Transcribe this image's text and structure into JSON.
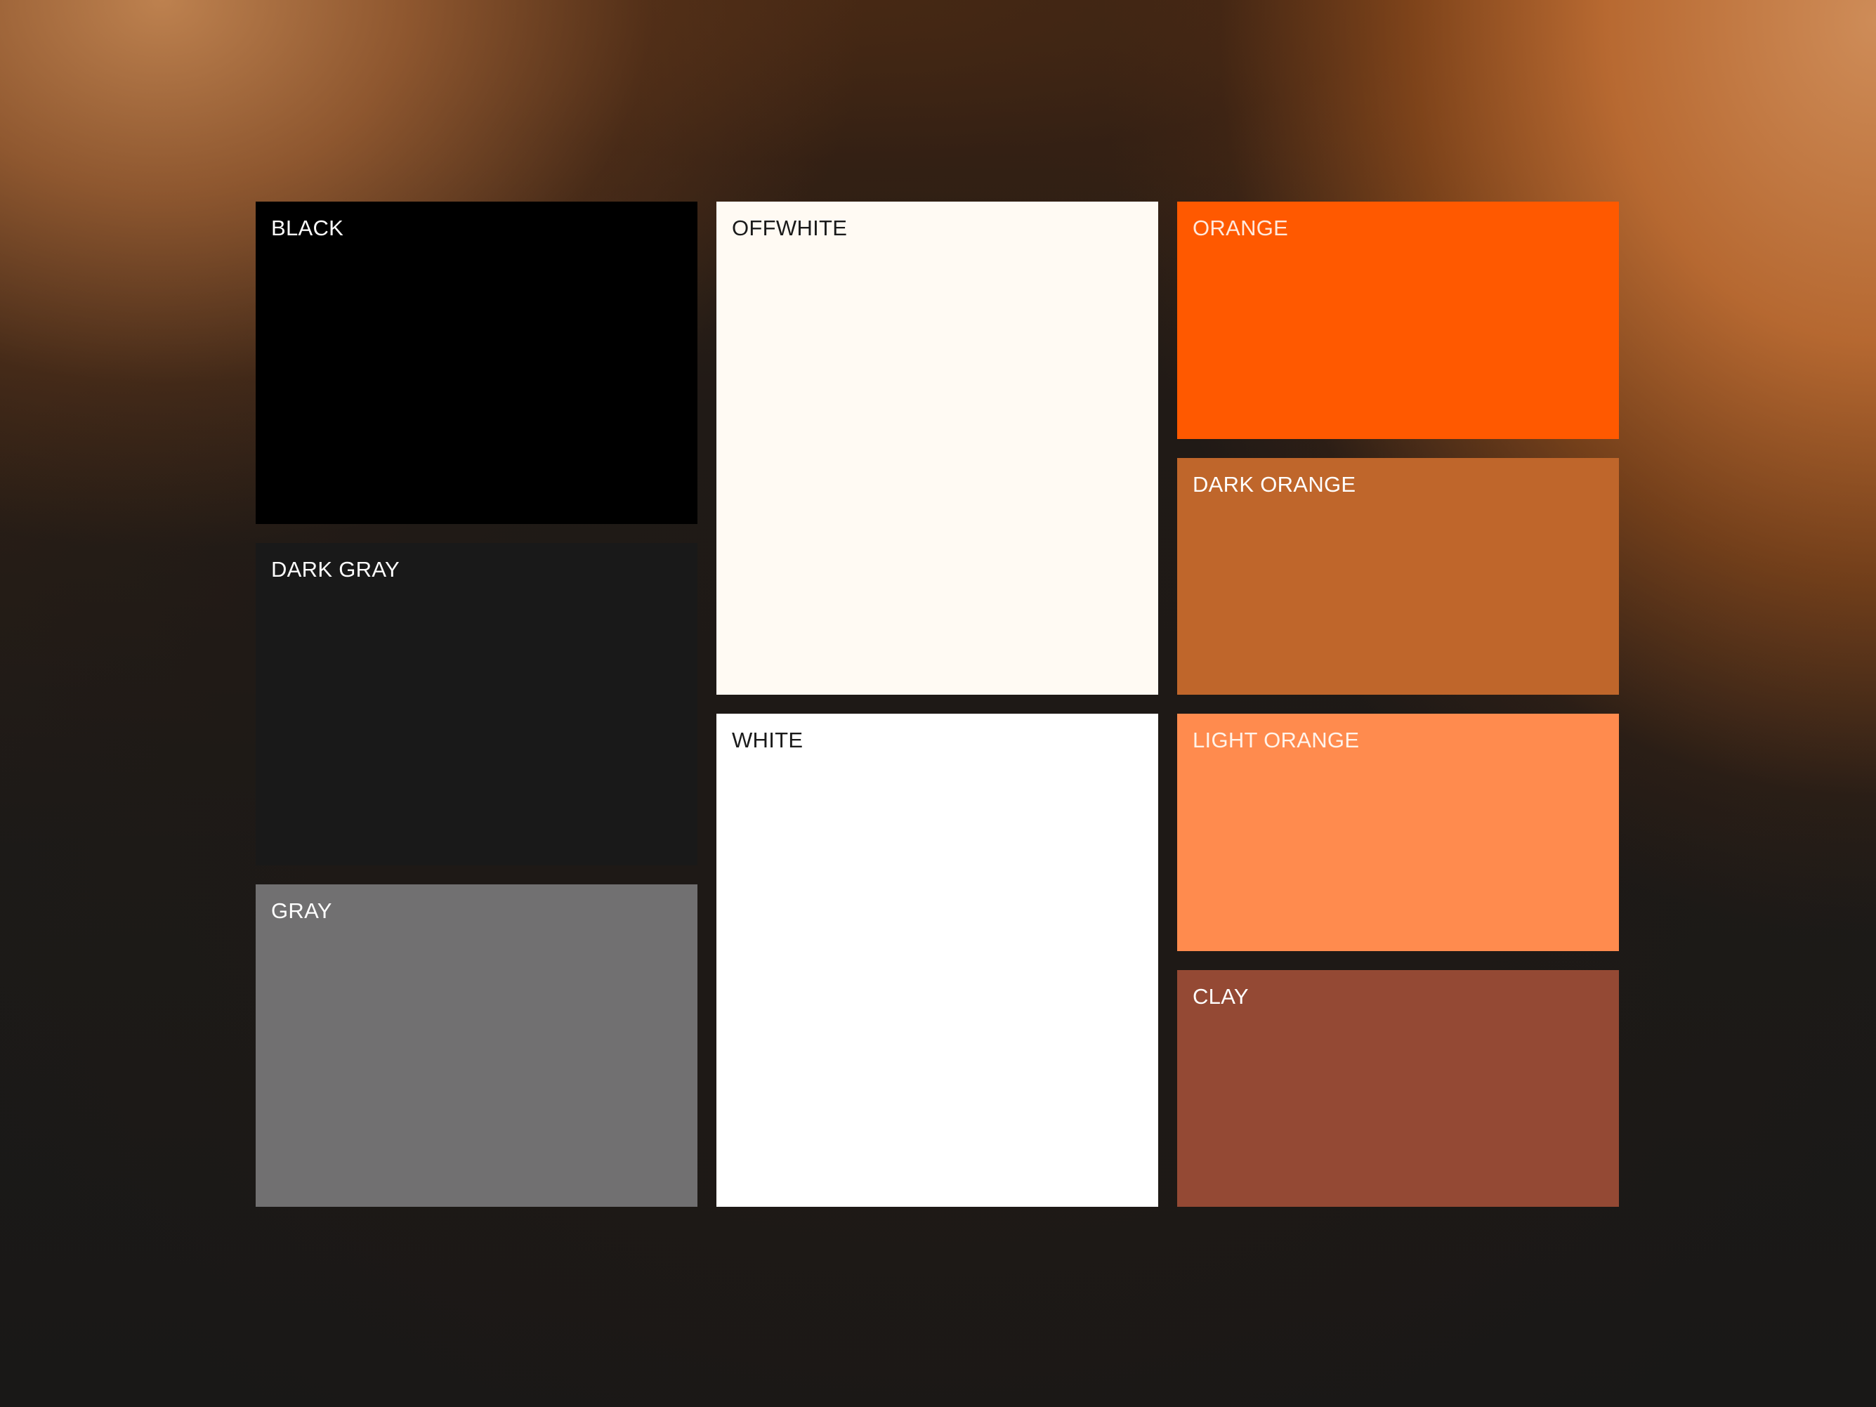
{
  "swatches": {
    "black": {
      "label": "BLACK",
      "color": "#000000",
      "text_color": "#ffffff"
    },
    "dark_gray": {
      "label": "DARK GRAY",
      "color": "#191919",
      "text_color": "#ffffff"
    },
    "gray": {
      "label": "GRAY",
      "color": "#717071",
      "text_color": "#ffffff"
    },
    "offwhite": {
      "label": "OFFWHITE",
      "color": "#fffaf3",
      "text_color": "#1a1a1a"
    },
    "white": {
      "label": "WHITE",
      "color": "#ffffff",
      "text_color": "#1a1a1a"
    },
    "orange": {
      "label": "ORANGE",
      "color": "#ff5900",
      "text_color": "#ffe9dc"
    },
    "dark_orange": {
      "label": "DARK ORANGE",
      "color": "#bf662b",
      "text_color": "#ffffff"
    },
    "light_orange": {
      "label": "LIGHT ORANGE",
      "color": "#ff8b4e",
      "text_color": "#fff3ea"
    },
    "clay": {
      "label": "CLAY",
      "color": "#944934",
      "text_color": "#ffffff"
    }
  }
}
